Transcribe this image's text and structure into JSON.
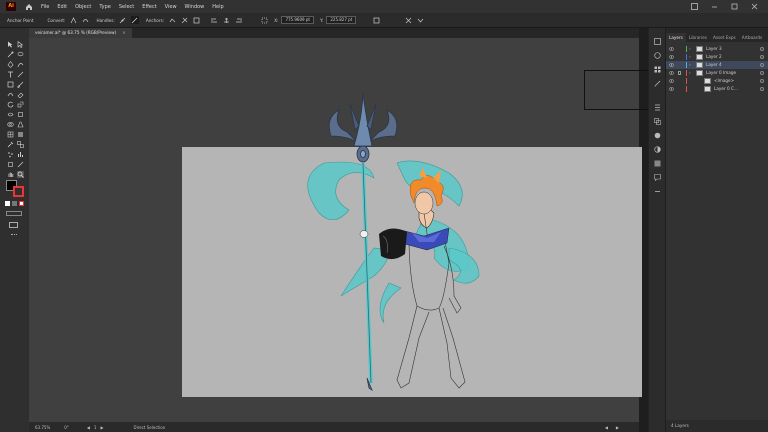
{
  "menubar": {
    "logo": "Ai",
    "items": [
      "File",
      "Edit",
      "Object",
      "Type",
      "Select",
      "Effect",
      "View",
      "Window",
      "Help"
    ]
  },
  "controlbar": {
    "anchor_label": "Anchor Point",
    "convert_label": "Convert:",
    "handles_label": "Handles:",
    "anchors_label": "Anchors:",
    "x_value": "775.9609 pt",
    "y_value": "225.827 pt"
  },
  "document": {
    "tab_title": "veiramer.ai* @ 63.75 % (RGB/Preview)",
    "close": "×"
  },
  "statusbar": {
    "zoom": "63.75%",
    "rotation": "0°",
    "artboard": "1",
    "tool": "Direct Selection"
  },
  "panel": {
    "tabs": [
      "Layers",
      "Libraries",
      "Asset Exps",
      "Artboards"
    ],
    "active_tab": "Layers",
    "layers": [
      {
        "name": "Layer 3",
        "color": "#4fb34f",
        "selected": false,
        "indent": 0
      },
      {
        "name": "Layer 2",
        "color": "#4f6fe0",
        "selected": false,
        "indent": 0
      },
      {
        "name": "Layer 4",
        "color": "#4fb3e0",
        "selected": true,
        "indent": 0
      },
      {
        "name": "Layer 0 Image",
        "color": "#e04f4f",
        "selected": false,
        "indent": 0
      },
      {
        "name": "<Image>",
        "color": "#e04f4f",
        "selected": false,
        "indent": 1
      },
      {
        "name": "Layer 0 C...",
        "color": "#e04f4f",
        "selected": false,
        "indent": 1
      }
    ],
    "footer": "4 Layers"
  },
  "colors": {
    "accent": "#5ac8c8",
    "trident": "#5a6e8c",
    "artboard": "#b5b5b5"
  }
}
